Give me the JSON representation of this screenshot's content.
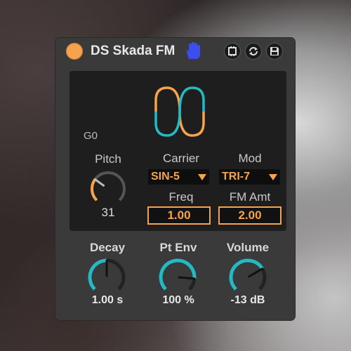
{
  "device": {
    "title": "DS Skada FM",
    "header_icons": [
      "hand-icon",
      "clip-icon",
      "swap-icon",
      "save-icon"
    ],
    "accent": "#f6a34d",
    "teal": "#25b9c4"
  },
  "screen": {
    "note": "G0",
    "pitch": {
      "label": "Pitch",
      "value": "31",
      "level": 0.3
    },
    "carrier": {
      "label": "Carrier",
      "selected": "SIN-5"
    },
    "mod": {
      "label": "Mod",
      "selected": "TRI-7"
    },
    "freq": {
      "label": "Freq",
      "value": "1.00"
    },
    "fm_amt": {
      "label": "FM Amt",
      "value": "2.00"
    }
  },
  "knobs": [
    {
      "label": "Decay",
      "value": "1.00 s",
      "level": 0.5
    },
    {
      "label": "Pt Env",
      "value": "100 %",
      "level": 0.85
    },
    {
      "label": "Volume",
      "value": "-13 dB",
      "level": 0.72
    }
  ]
}
